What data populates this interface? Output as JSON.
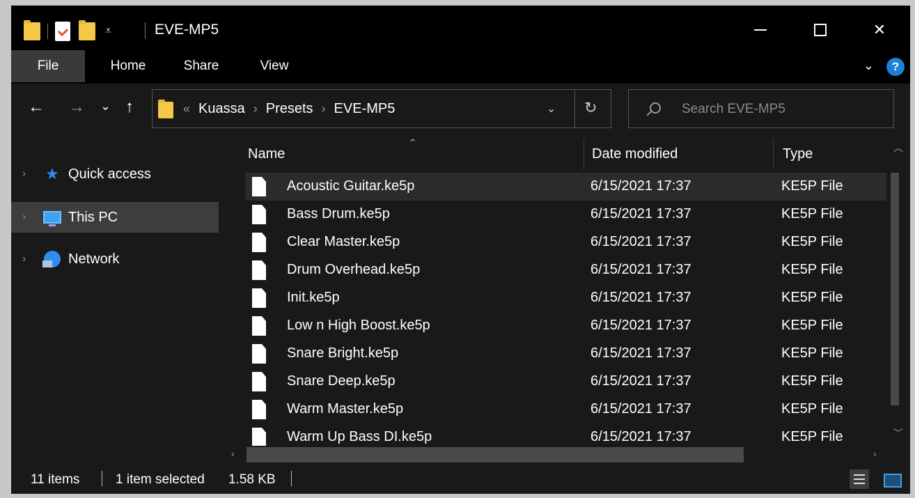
{
  "window": {
    "title": "EVE-MP5",
    "controls": {
      "minimize": "–",
      "maximize": "□",
      "close": "✕"
    }
  },
  "ribbon": {
    "tabs": [
      "File",
      "Home",
      "Share",
      "View"
    ],
    "help_label": "?"
  },
  "nav": {
    "back": "←",
    "forward": "→",
    "recent": "⌄",
    "up": "↑",
    "breadcrumb_prefix": "«",
    "breadcrumb": [
      "Kuassa",
      "Presets",
      "EVE-MP5"
    ],
    "separator": "›",
    "refresh": "↻",
    "dropdown": "⌄"
  },
  "search": {
    "placeholder": "Search EVE-MP5"
  },
  "sidebar": {
    "items": [
      {
        "label": "Quick access",
        "icon": "star-icon"
      },
      {
        "label": "This PC",
        "icon": "pc-icon",
        "selected": true
      },
      {
        "label": "Network",
        "icon": "network-icon"
      }
    ]
  },
  "columns": {
    "name": "Name",
    "date": "Date modified",
    "type": "Type"
  },
  "files": [
    {
      "name": "Acoustic Guitar.ke5p",
      "date": "6/15/2021 17:37",
      "type": "KE5P File"
    },
    {
      "name": "Bass Drum.ke5p",
      "date": "6/15/2021 17:37",
      "type": "KE5P File"
    },
    {
      "name": "Clear Master.ke5p",
      "date": "6/15/2021 17:37",
      "type": "KE5P File"
    },
    {
      "name": "Drum Overhead.ke5p",
      "date": "6/15/2021 17:37",
      "type": "KE5P File"
    },
    {
      "name": "Init.ke5p",
      "date": "6/15/2021 17:37",
      "type": "KE5P File"
    },
    {
      "name": "Low n High Boost.ke5p",
      "date": "6/15/2021 17:37",
      "type": "KE5P File"
    },
    {
      "name": "Snare Bright.ke5p",
      "date": "6/15/2021 17:37",
      "type": "KE5P File"
    },
    {
      "name": "Snare Deep.ke5p",
      "date": "6/15/2021 17:37",
      "type": "KE5P File"
    },
    {
      "name": "Warm Master.ke5p",
      "date": "6/15/2021 17:37",
      "type": "KE5P File"
    },
    {
      "name": "Warm Up Bass DI.ke5p",
      "date": "6/15/2021 17:37",
      "type": "KE5P File"
    }
  ],
  "status": {
    "count": "11 items",
    "selected": "1 item selected",
    "size": "1.58 KB"
  },
  "colors": {
    "accent": "#1d7fd8",
    "folder": "#f6c848",
    "background": "#191919"
  }
}
